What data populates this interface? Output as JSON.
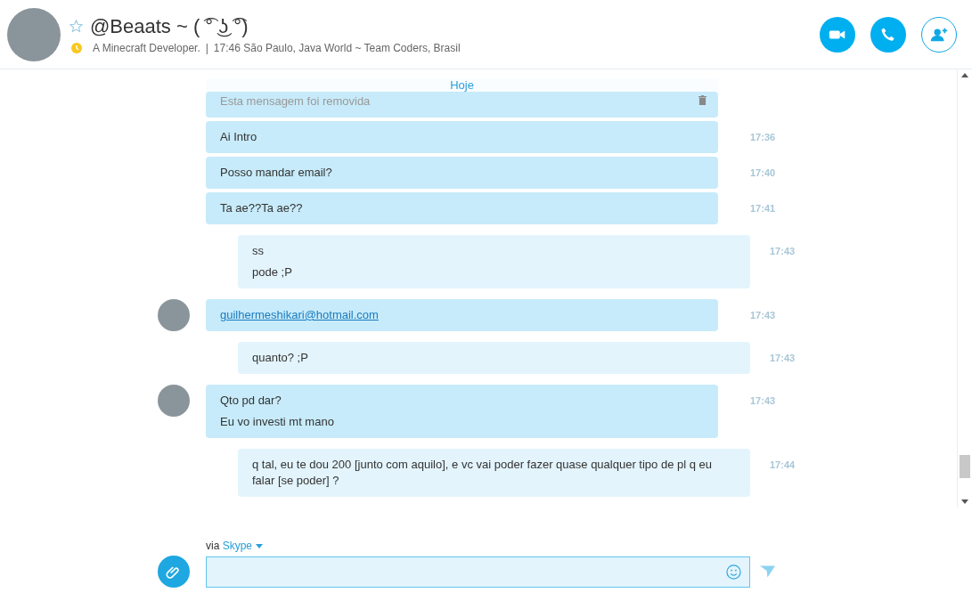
{
  "header": {
    "name": "@Beaats ~ ( ͡° ͜ʖ ͡°)",
    "favorite": false,
    "mood": "A Minecraft Developer.",
    "separator": "|",
    "location": "17:46 São Paulo, Java World ~ Team Coders, Brasil"
  },
  "date_divider": "Hoje",
  "messages": [
    {
      "kind": "incoming",
      "avatar": false,
      "removed": true,
      "link": false,
      "lines": [
        "Esta mensagem foi removida"
      ]
    },
    {
      "kind": "incoming",
      "avatar": false,
      "removed": false,
      "link": false,
      "lines": [
        "Ai Intro"
      ],
      "time": "17:36"
    },
    {
      "kind": "incoming",
      "avatar": false,
      "removed": false,
      "link": false,
      "lines": [
        "Posso mandar email?"
      ],
      "time": "17:40"
    },
    {
      "kind": "incoming",
      "avatar": false,
      "removed": false,
      "link": false,
      "lines": [
        "Ta ae??Ta ae??"
      ],
      "time": "17:41"
    },
    {
      "kind": "outgoing",
      "avatar": false,
      "removed": false,
      "link": false,
      "lines": [
        "ss",
        "pode ;P"
      ],
      "time": "17:43"
    },
    {
      "kind": "incoming",
      "avatar": true,
      "removed": false,
      "link": true,
      "lines": [
        "guilhermeshikari@hotmail.com"
      ],
      "time": "17:43"
    },
    {
      "kind": "outgoing",
      "avatar": false,
      "removed": false,
      "link": false,
      "lines": [
        "quanto? ;P"
      ],
      "time": "17:43"
    },
    {
      "kind": "incoming",
      "avatar": true,
      "removed": false,
      "link": false,
      "lines": [
        "Qto pd dar?",
        "Eu vo investi mt mano"
      ],
      "time": "17:43"
    },
    {
      "kind": "outgoing",
      "avatar": false,
      "removed": false,
      "link": false,
      "lines": [
        "q tal, eu te dou 200 [junto com aquilo], e vc vai poder fazer quase qualquer tipo de pl q eu falar [se poder] ?"
      ],
      "time": "17:44"
    }
  ],
  "composer": {
    "via_label": "via",
    "service": "Skype"
  }
}
